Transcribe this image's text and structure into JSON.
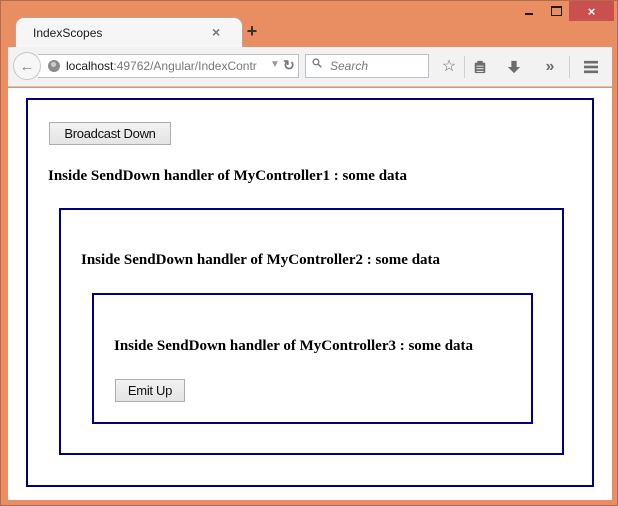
{
  "window": {
    "controls": {
      "minimize": "minimize",
      "maximize": "maximize",
      "close": "×"
    }
  },
  "browser": {
    "tab": {
      "title": "IndexScopes",
      "close": "×"
    },
    "new_tab": "+",
    "url": {
      "host": "localhost",
      "rest": ":49762/Angular/IndexContr"
    },
    "search": {
      "placeholder": "Search"
    },
    "toolbar_icons": [
      "bookmark-star-icon",
      "reading-list-icon",
      "download-icon",
      "overflow-chevron-icon",
      "menu-icon"
    ]
  },
  "page": {
    "controller1": {
      "button_label": "Broadcast Down",
      "message": "Inside SendDown handler of MyController1 : some data"
    },
    "controller2": {
      "message": "Inside SendDown handler of MyController2 : some data"
    },
    "controller3": {
      "message": "Inside SendDown handler of MyController3 : some data",
      "button_label": "Emit Up"
    },
    "border_color": "#000080"
  }
}
